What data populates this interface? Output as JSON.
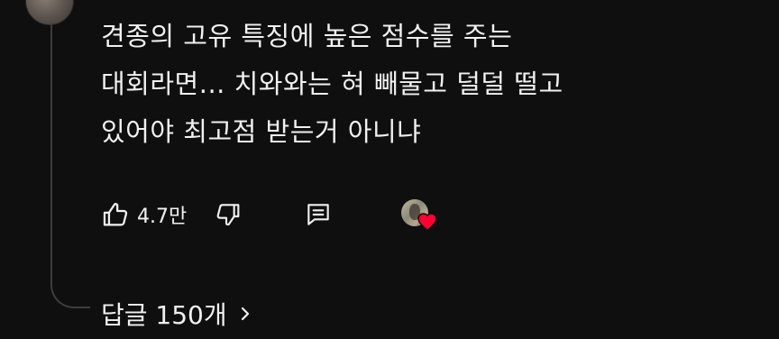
{
  "comment": {
    "lines": [
      "견종의 고유 특징에 높은 점수를 주는",
      "대회라면... 치와와는 혀 빼물고 덜덜 떨고",
      "있어야 최고점 받는거 아니냐"
    ]
  },
  "actions": {
    "like_count": "4.7만",
    "like_icon": "thumbs-up-icon",
    "dislike_icon": "thumbs-down-icon",
    "reply_icon": "comment-icon",
    "creator_heart_icon": "heart-icon"
  },
  "replies": {
    "label": "답글 150개"
  },
  "colors": {
    "background": "#0f0f0f",
    "text": "#f1f1f1",
    "heart": "#ff0033",
    "thread_line": "#3d3d3d"
  }
}
